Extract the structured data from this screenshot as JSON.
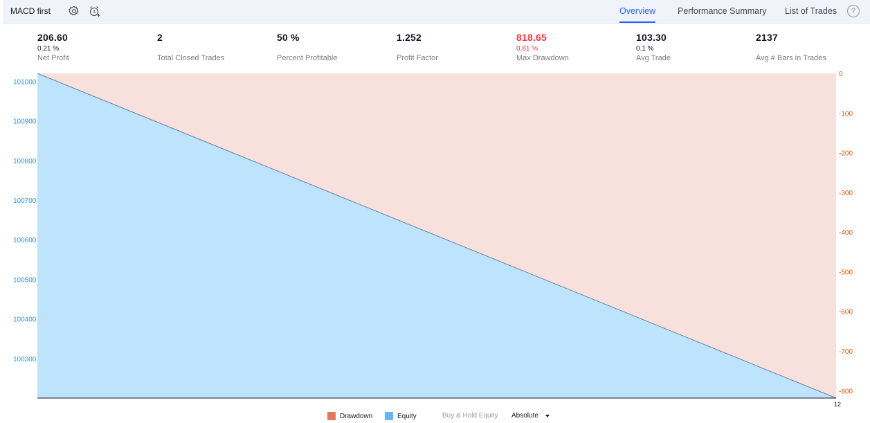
{
  "header": {
    "strategy_name": "MACD first",
    "tabs": [
      "Overview",
      "Performance Summary",
      "List of Trades"
    ],
    "active_tab": "Overview",
    "help_label": "?"
  },
  "metrics": [
    {
      "value": "206.60",
      "percent": "0.21 %",
      "label": "Net Profit"
    },
    {
      "value": "2",
      "percent": "",
      "label": "Total Closed Trades"
    },
    {
      "value": "50 %",
      "percent": "",
      "label": "Percent Profitable"
    },
    {
      "value": "1.252",
      "percent": "",
      "label": "Profit Factor"
    },
    {
      "value": "818.65",
      "percent": "0.81 %",
      "label": "Max Drawdown"
    },
    {
      "value": "103.30",
      "percent": "0.1 %",
      "label": "Avg Trade"
    },
    {
      "value": "2137",
      "percent": "",
      "label": "Avg # Bars in Trades"
    }
  ],
  "colors": {
    "equity_fill": "#bee3fc",
    "drawdown_fill": "#f8e1dd",
    "equity_axis": "#2196f3",
    "drawdown_axis": "#e65100",
    "line": "#5f7ea8",
    "accent": "#2962ff",
    "red": "#f23645"
  },
  "chart_data": {
    "type": "area",
    "series": [
      {
        "name": "Equity",
        "x": [
          0,
          12
        ],
        "y": [
          101020,
          100200
        ],
        "axis": "left"
      },
      {
        "name": "Drawdown",
        "x": [
          0,
          12
        ],
        "y": [
          0,
          -818.65
        ],
        "axis": "right"
      }
    ],
    "left_axis": {
      "ticks": [
        101000,
        100900,
        100800,
        100700,
        100600,
        100500,
        100400,
        100300
      ]
    },
    "right_axis": {
      "ticks": [
        0,
        -100,
        -200,
        -300,
        -400,
        -500,
        -600,
        -700,
        -800
      ]
    },
    "x_tick_labels": [
      "12"
    ],
    "legend_placement": "bottom-center"
  },
  "legend": {
    "drawdown": "Drawdown",
    "equity": "Equity",
    "buy_hold": "Buy & Hold Equity",
    "mode": "Absolute"
  }
}
